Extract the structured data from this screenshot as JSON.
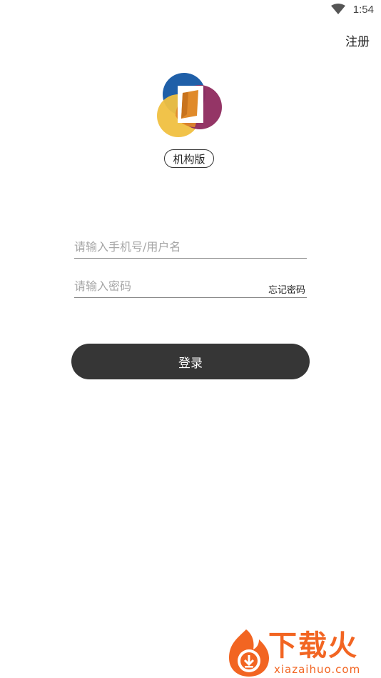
{
  "status_bar": {
    "time": "1:54",
    "wifi_icon": "wifi-icon"
  },
  "header": {
    "register_label": "注册"
  },
  "logo": {
    "icon": "app-logo",
    "colors": {
      "blue": "#1f5fa8",
      "yellow": "#f0c040",
      "maroon": "#8e2a5e",
      "orange": "#e08a2a"
    }
  },
  "edition": {
    "label": "机构版"
  },
  "form": {
    "username_placeholder": "请输入手机号/用户名",
    "username_value": "",
    "password_placeholder": "请输入密码",
    "password_value": "",
    "forgot_label": "忘记密码",
    "login_label": "登录"
  },
  "watermark": {
    "brand": "下载火",
    "domain": "xiazaihuo.com",
    "color": "#f26522"
  }
}
